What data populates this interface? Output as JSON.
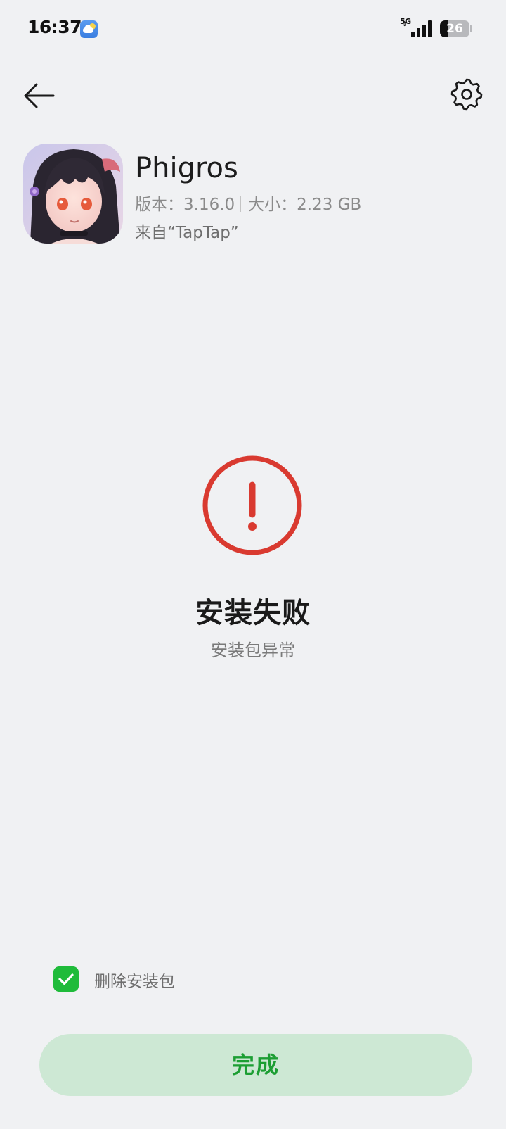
{
  "status_bar": {
    "time": "16:37",
    "network": "5G",
    "battery_level": "26",
    "battery_fraction": 0.26,
    "icons": [
      "weather-icon",
      "data-arrows-icon",
      "signal-icon",
      "battery-icon"
    ]
  },
  "top_bar": {
    "back_icon": "arrow-left-icon",
    "settings_icon": "gear-icon"
  },
  "app": {
    "name": "Phigros",
    "version_label": "版本：",
    "version": "3.16.0",
    "size_label": "大小：",
    "size": "2.23 GB",
    "source": "来自“TapTap”"
  },
  "result": {
    "icon": "exclamation-circle-icon",
    "title": "安装失败",
    "subtitle": "安装包异常"
  },
  "footer": {
    "delete_package_label": "删除安装包",
    "delete_package_checked": true,
    "done_label": "完成"
  },
  "colors": {
    "background": "#f0f1f3",
    "error_red": "#d93a30",
    "accent_green": "#1fbb3a",
    "button_bg": "#cde8d4",
    "button_text": "#1c9e33"
  }
}
